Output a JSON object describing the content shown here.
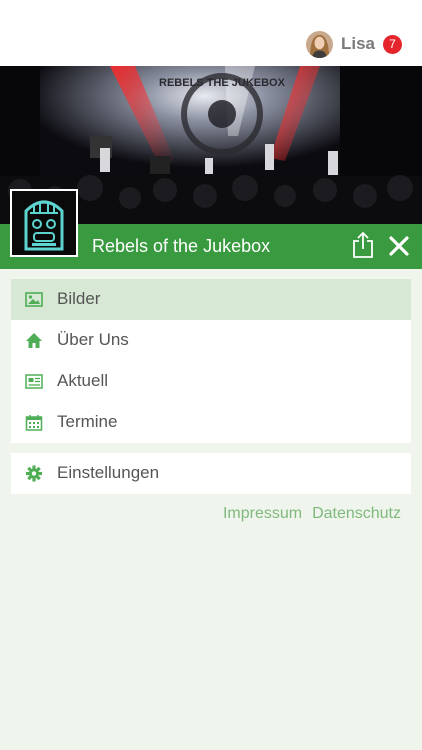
{
  "header": {
    "user_name": "Lisa",
    "notification_count": "7"
  },
  "band": {
    "name": "Rebels of the Jukebox",
    "banner_text": "REBELS THE JUKEBOX"
  },
  "menu": [
    {
      "label": "Bilder",
      "icon": "image-icon",
      "active": true
    },
    {
      "label": "Über Uns",
      "icon": "home-icon",
      "active": false
    },
    {
      "label": "Aktuell",
      "icon": "newspaper-icon",
      "active": false
    },
    {
      "label": "Termine",
      "icon": "calendar-icon",
      "active": false
    }
  ],
  "settings": {
    "label": "Einstellungen",
    "icon": "gear-icon"
  },
  "footer": {
    "impressum": "Impressum",
    "datenschutz": "Datenschutz"
  },
  "colors": {
    "accent_green": "#399a3f",
    "active_bg": "#d7e8d4",
    "page_bg": "#eff5ed",
    "link_green": "#7fb97c",
    "badge_red": "#e4262c"
  }
}
